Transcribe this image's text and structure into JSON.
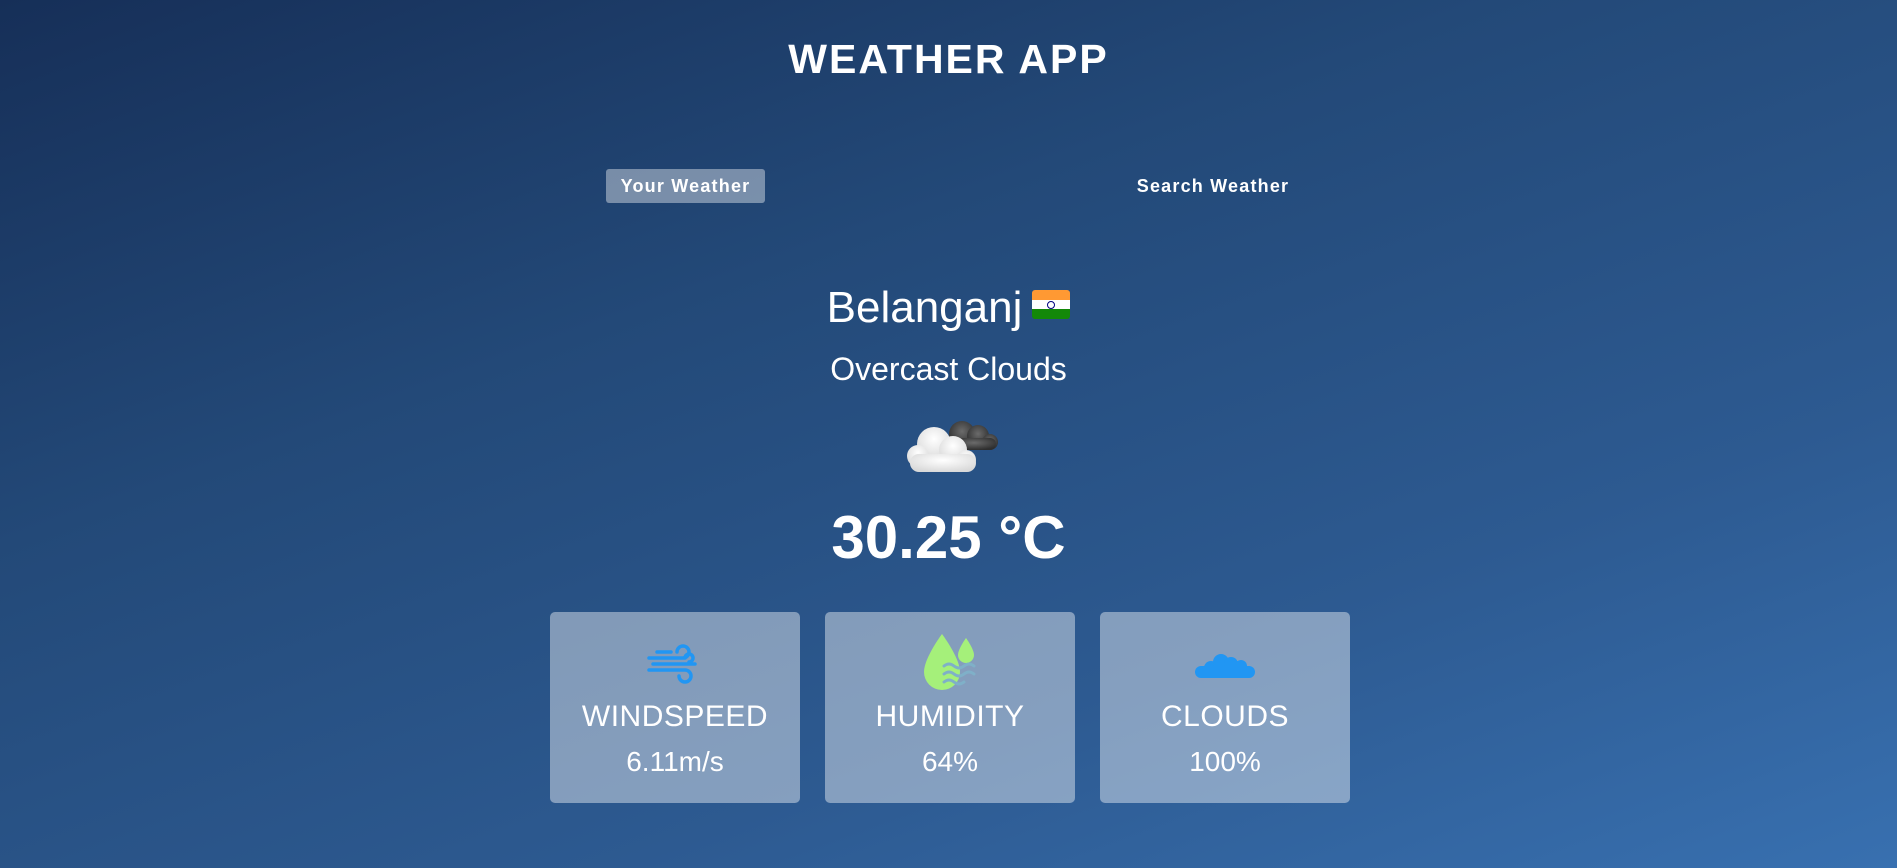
{
  "app": {
    "title": "WEATHER APP"
  },
  "tabs": {
    "your_weather": "Your Weather",
    "search_weather": "Search Weather",
    "active": "Your Weather"
  },
  "location": {
    "city": "Belanganj",
    "country_flag_icon": "india-flag-icon"
  },
  "weather": {
    "description": "Overcast Clouds",
    "condition_icon": "overcast-clouds-icon",
    "temperature": "30.25 °C"
  },
  "stats": {
    "windspeed": {
      "label": "WINDSPEED",
      "value": "6.11m/s",
      "icon": "wind-icon",
      "icon_color": "#2196f3"
    },
    "humidity": {
      "label": "HUMIDITY",
      "value": "64%",
      "icon": "humidity-drops-icon",
      "icon_color": "#a5f07a"
    },
    "clouds": {
      "label": "CLOUDS",
      "value": "100%",
      "icon": "clouds-icon",
      "icon_color": "#2196f3"
    }
  },
  "colors": {
    "background_start": "#162f58",
    "background_end": "#3870b0",
    "text": "#ffffff",
    "card_background": "rgba(255,255,255,0.42)"
  }
}
